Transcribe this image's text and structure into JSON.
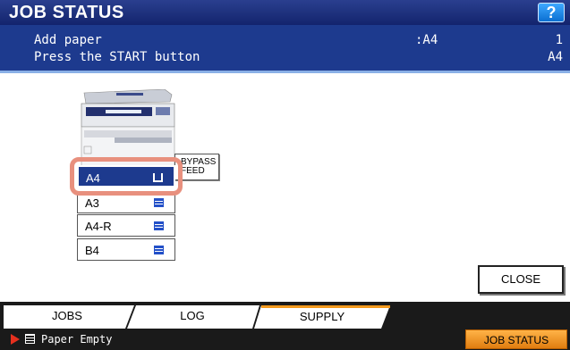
{
  "header": {
    "title": "JOB STATUS",
    "help_label": "?"
  },
  "message": {
    "line1": "Add paper",
    "line2": "Press the START button",
    "paper_size_req": ":A4",
    "count": "1",
    "paper_size_sel": "A4"
  },
  "trays": [
    {
      "label": "A4",
      "selected": true
    },
    {
      "label": "A3",
      "selected": false
    },
    {
      "label": "A4-R",
      "selected": false
    },
    {
      "label": "B4",
      "selected": false
    }
  ],
  "bypass": {
    "line1": "BYPASS",
    "line2": "FEED"
  },
  "buttons": {
    "close": "CLOSE",
    "job_status": "JOB STATUS"
  },
  "tabs": [
    {
      "label": "JOBS",
      "active": false
    },
    {
      "label": "LOG",
      "active": false
    },
    {
      "label": "SUPPLY",
      "active": true
    }
  ],
  "status": {
    "text": "Paper Empty"
  },
  "colors": {
    "title_bar": "#13246d",
    "message_bar": "#1d3a8e",
    "highlight": "#e8907e",
    "active_tab_accent": "#f39a1e"
  }
}
